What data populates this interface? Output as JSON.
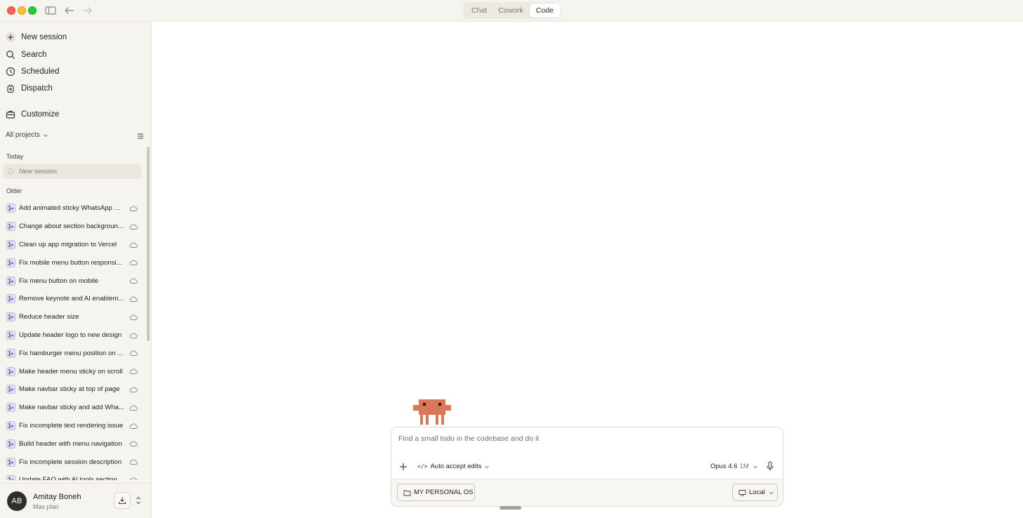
{
  "titlebar": {
    "tabs": [
      {
        "label": "Chat",
        "active": false
      },
      {
        "label": "Cowork",
        "active": false
      },
      {
        "label": "Code",
        "active": true
      }
    ]
  },
  "sidebar": {
    "nav": [
      {
        "label": "New session",
        "icon": "plus-icon"
      },
      {
        "label": "Search",
        "icon": "search-icon"
      },
      {
        "label": "Scheduled",
        "icon": "clock-icon"
      },
      {
        "label": "Dispatch",
        "icon": "dispatch-icon"
      },
      {
        "label": "Customize",
        "icon": "briefcase-icon"
      }
    ],
    "projects_filter": "All projects",
    "today_label": "Today",
    "today_session": "New session",
    "older_label": "Older",
    "sessions": [
      "Add animated sticky WhatsApp ...",
      "Change about section backgroun...",
      "Clean up app migration to Vercel",
      "Fix mobile menu button responsi...",
      "Fix menu button on mobile",
      "Remove keynote and AI enablem...",
      "Reduce header size",
      "Update header logo to new design",
      "Fix hamburger menu position on ...",
      "Make header menu sticky on scroll",
      "Make navbar sticky at top of page",
      "Make navbar sticky and add Wha...",
      "Fix incomplete text rendering issue",
      "Build header with menu navigation",
      "Fix incomplete session description",
      "Update FAQ with AI tools section"
    ],
    "user": {
      "initials": "AB",
      "name": "Amitay Boneh",
      "plan": "Max plan"
    }
  },
  "composer": {
    "placeholder": "Find a small todo in the codebase and do it",
    "mode_label": "Auto accept edits",
    "model": "Opus 4.6",
    "model_context": "1M",
    "folder": "MY PERSONAL OS",
    "environment": "Local"
  },
  "colors": {
    "sidebar_bg": "#f5f4ef",
    "mascot": "#d97757",
    "accent_close": "#fe5f57",
    "accent_min": "#febc2e",
    "accent_max": "#28c840"
  }
}
